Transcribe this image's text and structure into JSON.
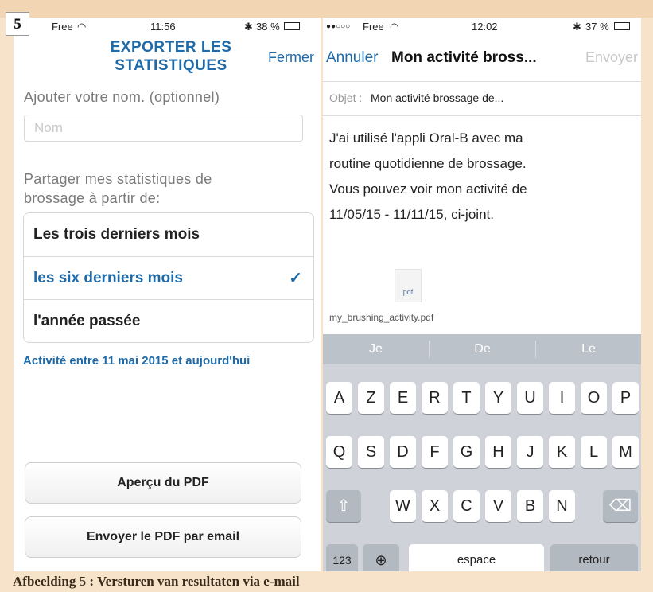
{
  "figure_badge": "5",
  "caption": "Afbeelding 5 : Versturen van resultaten via e-mail",
  "left": {
    "status": {
      "carrier": "Free",
      "wifi": "◠",
      "time": "11:56",
      "bluetooth": "✱",
      "battery": "38 %"
    },
    "nav": {
      "title_line1": "EXPORTER LES",
      "title_line2": "STATISTIQUES",
      "close": "Fermer"
    },
    "name_label": "Ajouter votre nom. (optionnel)",
    "name_placeholder": "Nom",
    "share_label_line1": "Partager mes statistiques de",
    "share_label_line2": "brossage à partir de:",
    "options": [
      {
        "label": "Les trois derniers mois",
        "selected": false
      },
      {
        "label": "les six derniers mois",
        "selected": true
      },
      {
        "label": "l'année passée",
        "selected": false
      }
    ],
    "checkmark": "✓",
    "range_note": "Activité entre 11 mai 2015 et aujourd'hui",
    "preview_button": "Aperçu du PDF",
    "email_button": "Envoyer le PDF par email"
  },
  "right": {
    "status": {
      "signal": "●●○○○",
      "carrier": "Free",
      "wifi": "◠",
      "time": "12:02",
      "bluetooth": "✱",
      "battery": "37 %"
    },
    "nav": {
      "cancel": "Annuler",
      "title": "Mon activité bross...",
      "send": "Envoyer"
    },
    "subject_label": "Objet :",
    "subject_value": "Mon activité brossage de...",
    "body_lines": [
      "J'ai utilisé l'appli Oral-B avec ma",
      "routine quotidienne de brossage.",
      "Vous pouvez voir mon activité de",
      "11/05/15 - 11/11/15, ci-joint."
    ],
    "attachment_icon_text": "pdf",
    "attachment_name": "my_brushing_activity.pdf",
    "keyboard": {
      "suggestions": [
        "Je",
        "De",
        "Le"
      ],
      "row1": [
        "A",
        "Z",
        "E",
        "R",
        "T",
        "Y",
        "U",
        "I",
        "O",
        "P"
      ],
      "row2": [
        "Q",
        "S",
        "D",
        "F",
        "G",
        "H",
        "J",
        "K",
        "L",
        "M"
      ],
      "row3": [
        "W",
        "X",
        "C",
        "V",
        "B",
        "N"
      ],
      "shift_icon": "⇧",
      "delete_icon": "⌫",
      "numbers": "123",
      "globe_icon": "⊕",
      "space": "espace",
      "return": "retour"
    }
  }
}
